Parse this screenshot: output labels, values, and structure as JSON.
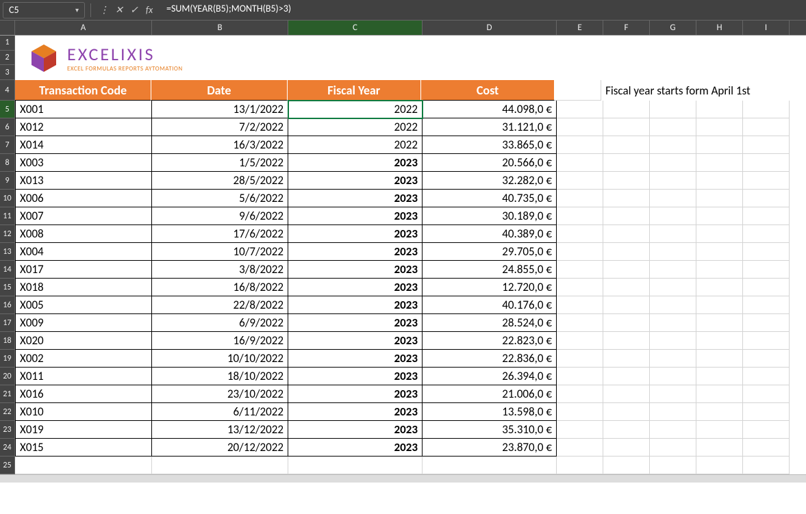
{
  "formula_bar": {
    "cell_ref": "C5",
    "formula": "=SUM(YEAR(B5);MONTH(B5)>3)"
  },
  "columns": [
    "A",
    "B",
    "C",
    "D",
    "E",
    "F",
    "G",
    "H",
    "I"
  ],
  "logo": {
    "name": "EXCELIXIS",
    "tagline": "EXCEL FORMULAS REPORTS AYTOMATION"
  },
  "headers": {
    "code": "Transaction Code",
    "date": "Date",
    "fy": "Fiscal Year",
    "cost": "Cost"
  },
  "note": "Fiscal year starts form April 1st",
  "rows": [
    {
      "n": "5",
      "code": "X001",
      "date": "13/1/2022",
      "fy": "2022",
      "fybold": false,
      "cost": "44.098,0 €"
    },
    {
      "n": "6",
      "code": "X012",
      "date": "7/2/2022",
      "fy": "2022",
      "fybold": false,
      "cost": "31.121,0 €"
    },
    {
      "n": "7",
      "code": "X014",
      "date": "16/3/2022",
      "fy": "2022",
      "fybold": false,
      "cost": "33.865,0 €"
    },
    {
      "n": "8",
      "code": "X003",
      "date": "1/5/2022",
      "fy": "2023",
      "fybold": true,
      "cost": "20.566,0 €"
    },
    {
      "n": "9",
      "code": "X013",
      "date": "28/5/2022",
      "fy": "2023",
      "fybold": true,
      "cost": "32.282,0 €"
    },
    {
      "n": "10",
      "code": "X006",
      "date": "5/6/2022",
      "fy": "2023",
      "fybold": true,
      "cost": "40.735,0 €"
    },
    {
      "n": "11",
      "code": "X007",
      "date": "9/6/2022",
      "fy": "2023",
      "fybold": true,
      "cost": "30.189,0 €"
    },
    {
      "n": "12",
      "code": "X008",
      "date": "17/6/2022",
      "fy": "2023",
      "fybold": true,
      "cost": "40.389,0 €"
    },
    {
      "n": "13",
      "code": "X004",
      "date": "10/7/2022",
      "fy": "2023",
      "fybold": true,
      "cost": "29.705,0 €"
    },
    {
      "n": "14",
      "code": "X017",
      "date": "3/8/2022",
      "fy": "2023",
      "fybold": true,
      "cost": "24.855,0 €"
    },
    {
      "n": "15",
      "code": "X018",
      "date": "16/8/2022",
      "fy": "2023",
      "fybold": true,
      "cost": "12.720,0 €"
    },
    {
      "n": "16",
      "code": "X005",
      "date": "22/8/2022",
      "fy": "2023",
      "fybold": true,
      "cost": "40.176,0 €"
    },
    {
      "n": "17",
      "code": "X009",
      "date": "6/9/2022",
      "fy": "2023",
      "fybold": true,
      "cost": "28.524,0 €"
    },
    {
      "n": "18",
      "code": "X020",
      "date": "16/9/2022",
      "fy": "2023",
      "fybold": true,
      "cost": "22.823,0 €"
    },
    {
      "n": "19",
      "code": "X002",
      "date": "10/10/2022",
      "fy": "2023",
      "fybold": true,
      "cost": "22.836,0 €"
    },
    {
      "n": "20",
      "code": "X011",
      "date": "18/10/2022",
      "fy": "2023",
      "fybold": true,
      "cost": "26.394,0 €"
    },
    {
      "n": "21",
      "code": "X016",
      "date": "23/10/2022",
      "fy": "2023",
      "fybold": true,
      "cost": "21.006,0 €"
    },
    {
      "n": "22",
      "code": "X010",
      "date": "6/11/2022",
      "fy": "2023",
      "fybold": true,
      "cost": "13.598,0 €"
    },
    {
      "n": "23",
      "code": "X019",
      "date": "13/12/2022",
      "fy": "2023",
      "fybold": true,
      "cost": "35.310,0 €"
    },
    {
      "n": "24",
      "code": "X015",
      "date": "20/12/2022",
      "fy": "2023",
      "fybold": true,
      "cost": "23.870,0 €"
    }
  ],
  "row25": "25"
}
